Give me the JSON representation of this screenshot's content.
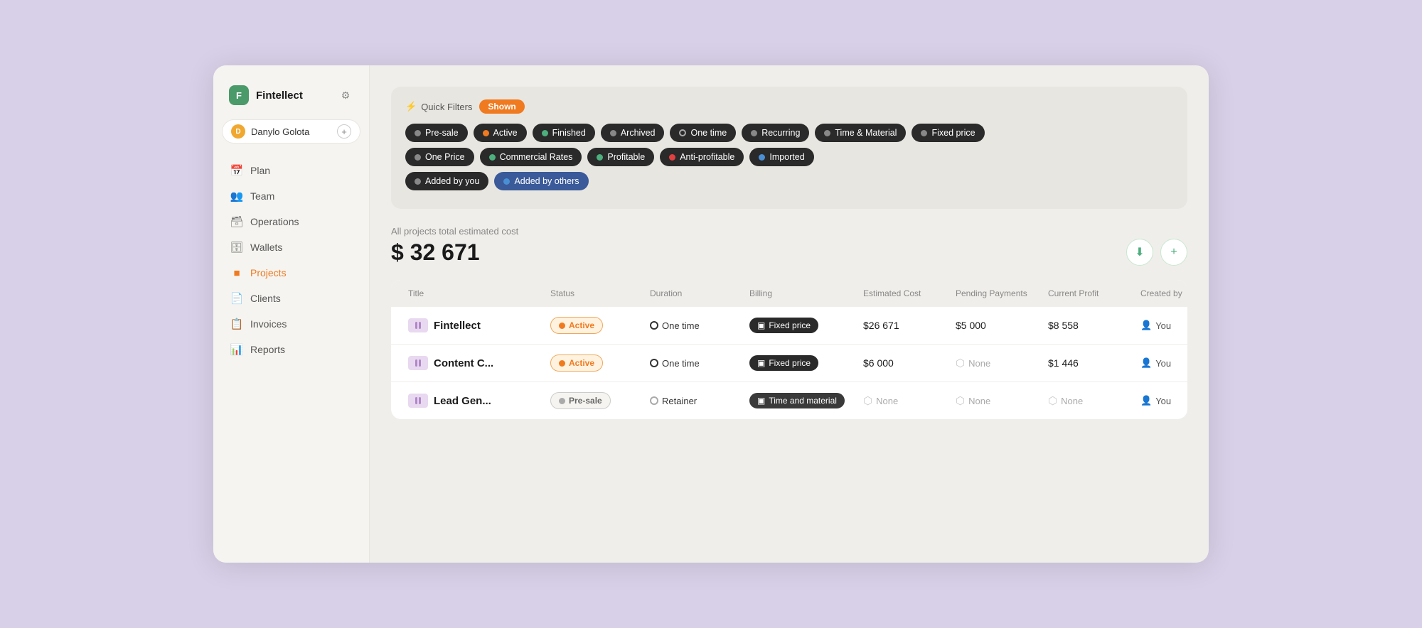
{
  "app": {
    "name": "Fintellect",
    "logo_letter": "F",
    "settings_icon": "⚙"
  },
  "user": {
    "name": "Danylo Golota",
    "initials": "D"
  },
  "nav": {
    "items": [
      {
        "id": "plan",
        "label": "Plan",
        "icon": "📅"
      },
      {
        "id": "team",
        "label": "Team",
        "icon": "👥"
      },
      {
        "id": "operations",
        "label": "Operations",
        "icon": "🗃"
      },
      {
        "id": "wallets",
        "label": "Wallets",
        "icon": "🗄"
      },
      {
        "id": "projects",
        "label": "Projects",
        "icon": "🟠",
        "active": true
      },
      {
        "id": "clients",
        "label": "Clients",
        "icon": "📄"
      },
      {
        "id": "invoices",
        "label": "Invoices",
        "icon": "📋"
      },
      {
        "id": "reports",
        "label": "Reports",
        "icon": "📊"
      }
    ]
  },
  "quick_filters": {
    "label": "Quick Filters",
    "shown_label": "Shown",
    "chips_row1": [
      {
        "id": "pre-sale",
        "label": "Pre-sale",
        "dot": "gray"
      },
      {
        "id": "active",
        "label": "Active",
        "dot": "orange"
      },
      {
        "id": "finished",
        "label": "Finished",
        "dot": "green"
      },
      {
        "id": "archived",
        "label": "Archived",
        "dot": "gray"
      },
      {
        "id": "one-time",
        "label": "One time",
        "dot": "dark"
      },
      {
        "id": "recurring",
        "label": "Recurring",
        "dot": "gray"
      },
      {
        "id": "time-material",
        "label": "Time & Material",
        "dot": "gray"
      },
      {
        "id": "fixed-price",
        "label": "Fixed price",
        "dot": "gray"
      }
    ],
    "chips_row2": [
      {
        "id": "one-price",
        "label": "One Price",
        "dot": "gray"
      },
      {
        "id": "commercial-rates",
        "label": "Commercial Rates",
        "dot": "green"
      },
      {
        "id": "profitable",
        "label": "Profitable",
        "dot": "green"
      },
      {
        "id": "anti-profitable",
        "label": "Anti-profitable",
        "dot": "red"
      },
      {
        "id": "imported",
        "label": "Imported",
        "dot": "blue"
      }
    ],
    "chips_row3": [
      {
        "id": "added-by-you",
        "label": "Added by you",
        "dot": "gray"
      },
      {
        "id": "added-by-others",
        "label": "Added by others",
        "dot": "blue"
      }
    ]
  },
  "summary": {
    "label": "All projects total estimated cost",
    "amount": "$ 32 671"
  },
  "table": {
    "headers": [
      "Title",
      "Status",
      "Duration",
      "Billing",
      "Estimated Cost",
      "Pending Payments",
      "Current Profit",
      "Created by"
    ],
    "rows": [
      {
        "id": "fintellect",
        "title": "Fintellect",
        "status": "Active",
        "status_type": "active",
        "duration": "One time",
        "billing": "Fixed price",
        "estimated_cost": "$26 671",
        "pending_payments": "$5 000",
        "current_profit": "$8 558",
        "created_by": "You"
      },
      {
        "id": "content-c",
        "title": "Content C...",
        "status": "Active",
        "status_type": "active",
        "duration": "One time",
        "billing": "Fixed price",
        "estimated_cost": "$6 000",
        "pending_payments": "None",
        "current_profit": "$1 446",
        "created_by": "You"
      },
      {
        "id": "lead-gen",
        "title": "Lead Gen...",
        "status": "Pre-sale",
        "status_type": "presale",
        "duration": "Retainer",
        "billing": "Time and material",
        "estimated_cost": "None",
        "pending_payments": "None",
        "current_profit": "None",
        "created_by": "You"
      }
    ]
  }
}
